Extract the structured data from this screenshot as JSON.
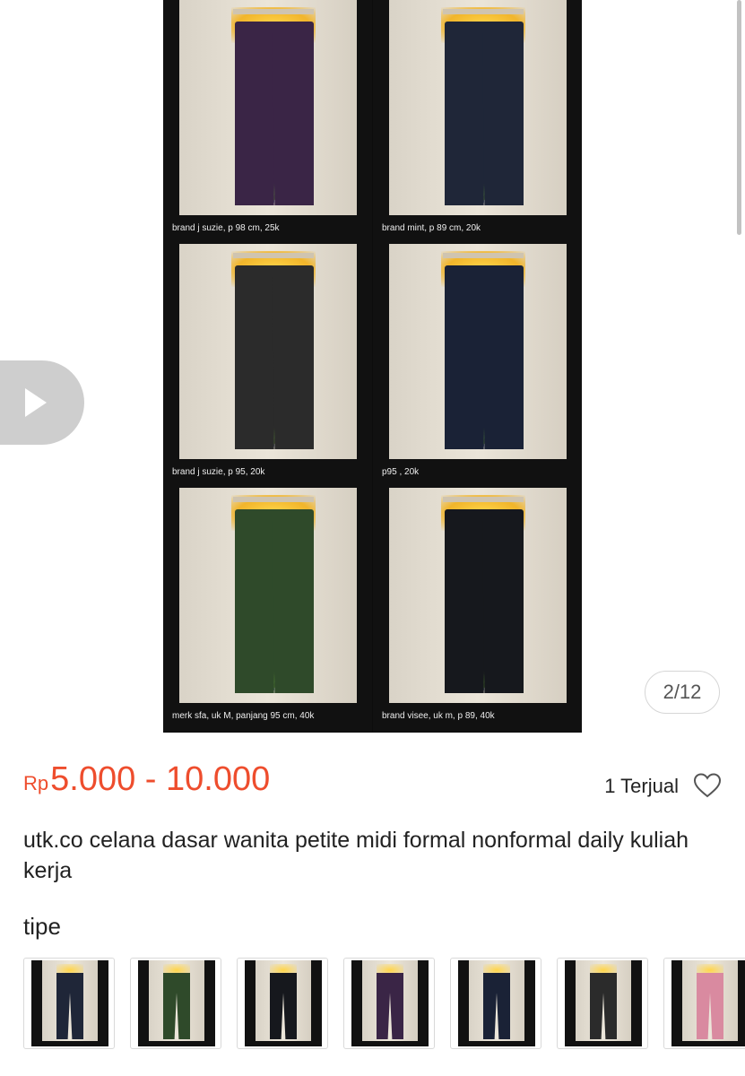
{
  "gallery": {
    "counter": "2/12",
    "items": [
      {
        "caption": "brand j suzie, p 98 cm, 25k",
        "color": "#3a2546"
      },
      {
        "caption": "brand mint, p 89 cm, 20k",
        "color": "#1f2638"
      },
      {
        "caption": "brand j suzie, p 95, 20k",
        "color": "#2b2b2b"
      },
      {
        "caption": "p95 , 20k",
        "color": "#1a2236"
      },
      {
        "caption": "merk sfa, uk M, panjang 95 cm, 40k",
        "color": "#2f4a2a"
      },
      {
        "caption": "brand visee, uk m, p 89, 40k",
        "color": "#16181d"
      }
    ]
  },
  "product": {
    "currency": "Rp",
    "price": "5.000 - 10.000",
    "sold": "1 Terjual",
    "title": "utk.co celana dasar wanita petite midi formal nonformal daily kuliah kerja",
    "accent_color": "#ee4d2d"
  },
  "variation": {
    "label": "tipe",
    "thumbs": [
      {
        "color": "#1f2638"
      },
      {
        "color": "#2f4a2a"
      },
      {
        "color": "#16181d"
      },
      {
        "color": "#3a2546"
      },
      {
        "color": "#1a2236"
      },
      {
        "color": "#2b2b2b"
      },
      {
        "color": "#d98aa0"
      }
    ]
  },
  "icons": {
    "prev": "play-arrow-icon",
    "favorite": "heart-icon"
  }
}
